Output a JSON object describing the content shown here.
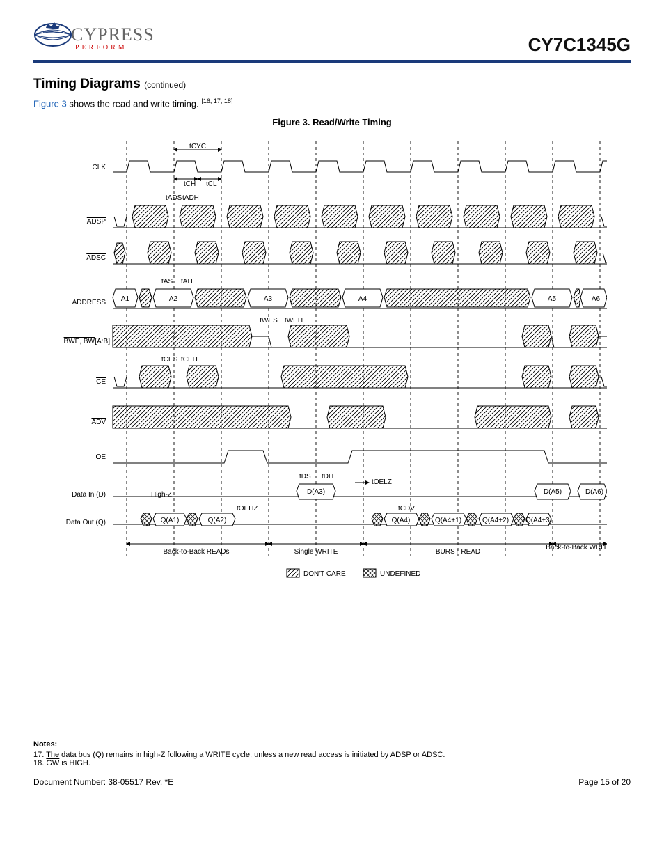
{
  "header": {
    "logo_name": "CYPRESS",
    "logo_tag": "PERFORM",
    "part_number": "CY7C1345G"
  },
  "section": {
    "title": "Timing Diagrams",
    "continued": "(continued)",
    "intro_link": "Figure 3",
    "intro_rest": "shows the read and write timing.",
    "intro_refs": "[16, 17, 18]"
  },
  "figure": {
    "title": "Figure 3. Read/Write Timing"
  },
  "signals": {
    "clk": "CLK",
    "adsp": "ADSP",
    "adsc": "ADSC",
    "address": "ADDRESS",
    "bwe": "BWE, BW",
    "bwe_sub": "[A:B]",
    "ce": "CE",
    "adv": "ADV",
    "oe": "OE",
    "din": "Data In (D)",
    "dout": "Data Out (Q)"
  },
  "timing": {
    "cyc": "tCYC",
    "ch": "tCH",
    "cl": "tCL",
    "ads": "tADS",
    "adh": "tADH",
    "as": "tAS",
    "ah": "tAH",
    "wes": "tWES",
    "weh": "tWEH",
    "ces": "tCES",
    "ceh": "tCEH",
    "ds": "tDS",
    "dh": "tDH",
    "oelz": "tOELZ",
    "oehz": "tOEHZ",
    "cdv": "tCDV"
  },
  "addr": {
    "a1": "A1",
    "a2": "A2",
    "a3": "A3",
    "a4": "A4",
    "a5": "A5",
    "a6": "A6"
  },
  "data": {
    "highz": "High-Z",
    "da3": "D(A3)",
    "da5": "D(A5)",
    "da6": "D(A6)",
    "qa1": "Q(A1)",
    "qa2": "Q(A2)",
    "qa4": "Q(A4)",
    "qa41": "Q(A4+1)",
    "qa42": "Q(A4+2)",
    "qa43": "Q(A4+3)"
  },
  "phases": {
    "r": "Back-to-Back READs",
    "w": "Single WRITE",
    "b": "BURST READ",
    "bw": "Back-to-Back WRITEs"
  },
  "legend": {
    "dc": "DON'T CARE",
    "ud": "UNDEFINED"
  },
  "notes": {
    "title": "Notes:",
    "n17": "The data bus (Q) remains in high-Z following a WRITE cycle, unless a new read access is initiated by ADSP or ADSC.",
    "n18": "GW is HIGH."
  },
  "footer": {
    "doc": "Document Number: 38-05517 Rev. *E",
    "page": "Page 15 of 20"
  }
}
